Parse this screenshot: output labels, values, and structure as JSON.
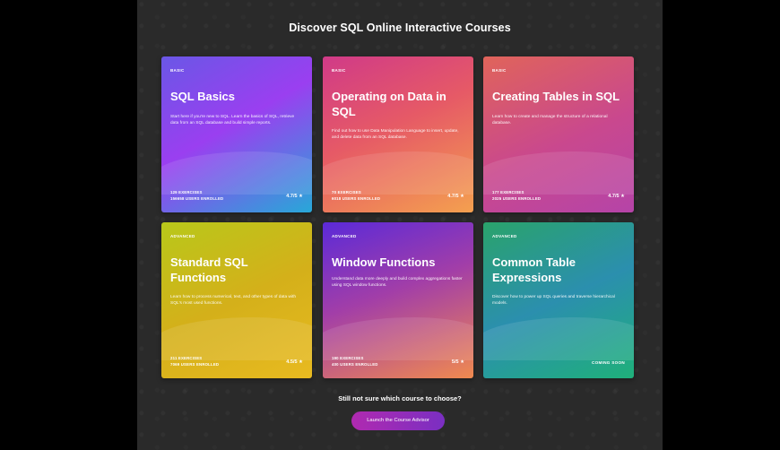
{
  "header": {
    "title": "Discover SQL Online Interactive Courses"
  },
  "courses": [
    {
      "level": "BASIC",
      "name": "SQL Basics",
      "description": "Start here if you're new to SQL. Learn the basics of SQL, retrieve data from an SQL database and build simple reports.",
      "exercises": "129 EXERCISES",
      "enrolled": "156658 USERS ENROLLED",
      "rating": "4.7/5 ★"
    },
    {
      "level": "BASIC",
      "name": "Operating on Data in SQL",
      "description": "Find out how to use Data Manipulation Language to insert, update, and delete data from an SQL database.",
      "exercises": "70 EXERCISES",
      "enrolled": "6018 USERS ENROLLED",
      "rating": "4.7/5 ★"
    },
    {
      "level": "BASIC",
      "name": "Creating Tables in SQL",
      "description": "Learn how to create and manage the structure of a relational database.",
      "exercises": "177 EXERCISES",
      "enrolled": "2025 USERS ENROLLED",
      "rating": "4.7/5 ★"
    },
    {
      "level": "ADVANCED",
      "name": "Standard SQL Functions",
      "description": "Learn how to process numerical, text, and other types of data with SQL's most used functions.",
      "exercises": "211 EXERCISES",
      "enrolled": "7069 USERS ENROLLED",
      "rating": "4.5/5 ★"
    },
    {
      "level": "ADVANCED",
      "name": "Window Functions",
      "description": "Understand data more deeply and build complex aggregations faster using SQL window functions.",
      "exercises": "190 EXERCISES",
      "enrolled": "400 USERS ENROLLED",
      "rating": "5/5 ★"
    },
    {
      "level": "ADVANCED",
      "name": "Common Table Expressions",
      "description": "Discover how to power up SQL queries and traverse hierarchical models.",
      "coming_soon": "COMING SOON"
    }
  ],
  "footer": {
    "prompt": "Still not sure which course to choose?",
    "button_label": "Launch the Course Advisor"
  },
  "colors": {
    "page_bg": "#000000",
    "stage_bg": "#2a2a2a",
    "card1": [
      "#6a57e6",
      "#9a3ff0",
      "#27a8d8"
    ],
    "card2": [
      "#d03a88",
      "#ee6b4b",
      "#f4a04f"
    ],
    "card3": [
      "#e0645a",
      "#c9488e",
      "#b544a8"
    ],
    "card4": [
      "#b8c81a",
      "#e2a20f",
      "#e8ba20"
    ],
    "card5": [
      "#5b2ad8",
      "#c14a9c",
      "#f08a4f"
    ],
    "card6": [
      "#2aa36b",
      "#2b8fae",
      "#1fb07a"
    ],
    "advisor_button": "#a12cb8"
  }
}
